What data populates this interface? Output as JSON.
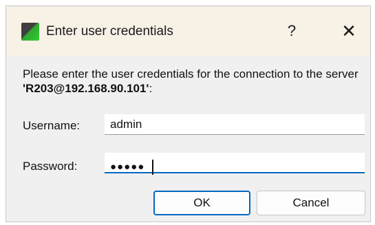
{
  "window": {
    "title": "Enter user credentials",
    "help_label": "?",
    "close_label": "✕"
  },
  "message": {
    "text_before": "Please enter the user credentials for the connection to the server ",
    "server": "'R203@192.168.90.101'",
    "text_after": ":"
  },
  "form": {
    "username_label": "Username:",
    "username_value": "admin",
    "password_label": "Password:",
    "password_mask": "●●●●●"
  },
  "buttons": {
    "ok_label": "OK",
    "cancel_label": "Cancel"
  },
  "colors": {
    "accent": "#0067c0",
    "titlebar": "#f7f1e6",
    "dialog_bg": "#f0f0f0"
  }
}
